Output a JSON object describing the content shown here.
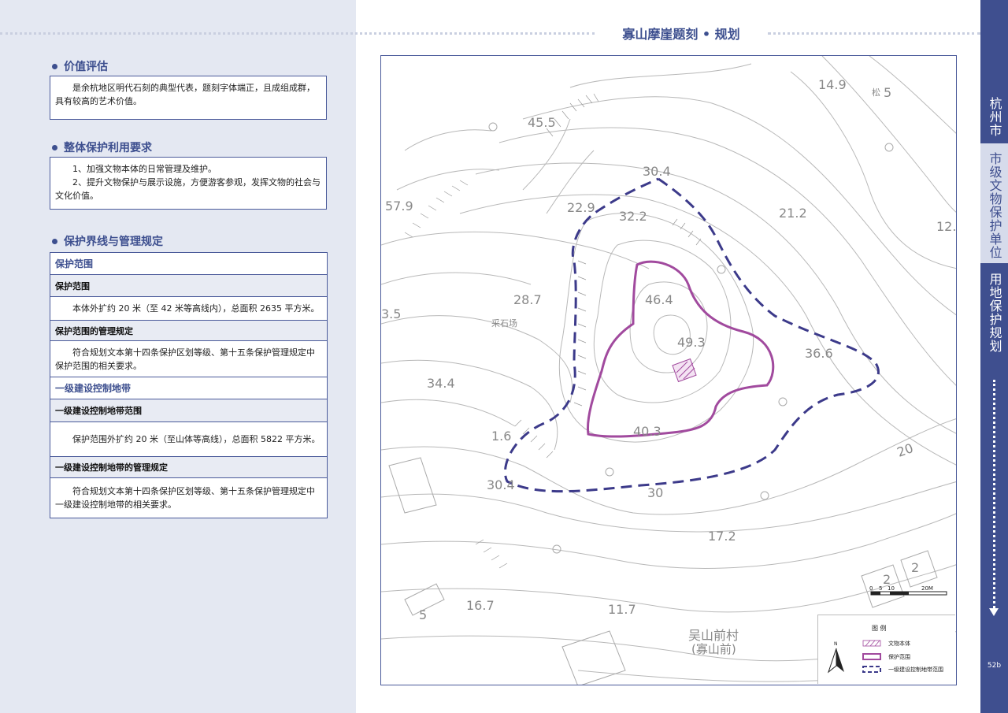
{
  "header": {
    "title": "寡山摩崖题刻 • 规划"
  },
  "sections": {
    "value": {
      "heading": "价值评估",
      "text": "是余杭地区明代石刻的典型代表，题刻字体端正，且成组成群，具有较高的艺术价值。"
    },
    "overall": {
      "heading": "整体保护利用要求",
      "line1": "1、加强文物本体的日常管理及维护。",
      "line2": "2、提升文物保护与展示设施，方便游客参观，发挥文物的社会与文化价值。"
    },
    "boundary": {
      "heading": "保护界线与管理规定",
      "band1": "保护范围",
      "sub1": "保护范围",
      "text1": "本体外扩约 20 米（至 42 米等高线内），总面积 2635 平方米。",
      "sub2": "保护范围的管理规定",
      "text2": "符合规划文本第十四条保护区划等级、第十五条保护管理规定中保护范围的相关要求。",
      "band2": "一级建设控制地带",
      "sub3": "一级建设控制地带范围",
      "text3": "保护范围外扩约 20 米（至山体等高线），总面积 5822 平方米。",
      "sub4": "一级建设控制地带的管理规定",
      "text4": "符合规划文本第十四条保护区划等级、第十五条保护管理规定中一级建设控制地带的相关要求。"
    }
  },
  "map": {
    "elevations": [
      "14.9",
      "5",
      "45.5",
      "30.4",
      "57.9",
      "22.9",
      "32.2",
      "21.2",
      "12.",
      "28.7",
      "46.4",
      "3.5",
      "49.3",
      "36.6",
      "34.4",
      "40.3",
      "1.6",
      "20",
      "30.4",
      "30",
      "17.2",
      "2",
      "2",
      "16.7",
      "5",
      "11.7"
    ],
    "labels": {
      "pine": "松",
      "quarry": "采石场",
      "village": "吴山前村",
      "village_alt": "(寡山前)",
      "north": "N"
    },
    "scale": {
      "ticks": [
        "0",
        "5",
        "10",
        "20M"
      ]
    },
    "legend": {
      "title": "图   例",
      "items": [
        "文物本体",
        "保护范围",
        "一级建设控制地带范围"
      ]
    },
    "colors": {
      "protection": "#a14a9e",
      "control": "#3c3a8a",
      "contour": "#b5b5b5"
    }
  },
  "sidebar": {
    "seg1": "杭州市",
    "seg2": "市级文物保护单位",
    "seg3": "用地保护规划",
    "page": "52b"
  }
}
